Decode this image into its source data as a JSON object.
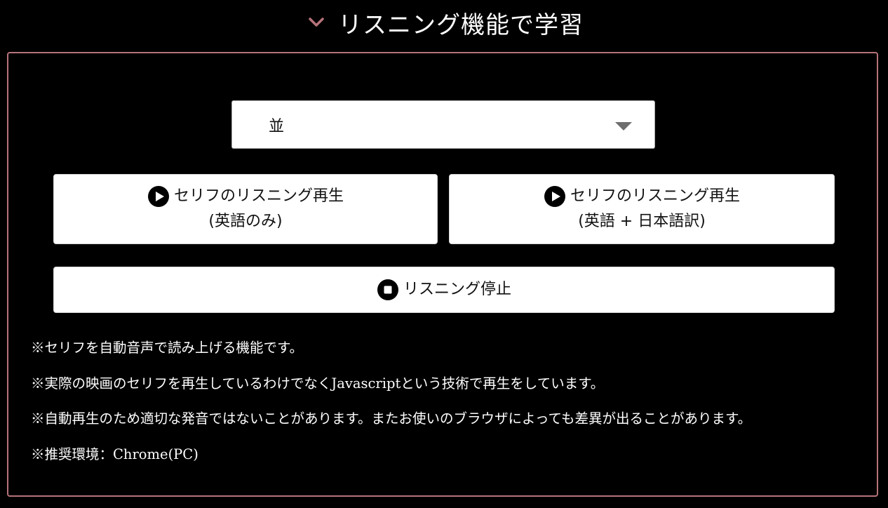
{
  "header": {
    "title": "リスニング機能で学習",
    "icon": "chevron-down-icon",
    "accent_color": "#b6737a"
  },
  "voice_select": {
    "value": "並"
  },
  "buttons": {
    "play_english": {
      "line1": "セリフのリスニング再生",
      "line2": "(英語のみ)",
      "icon": "play-circle-icon"
    },
    "play_english_japanese": {
      "line1": "セリフのリスニング再生",
      "line2": "(英語 + 日本語訳)",
      "icon": "play-circle-icon"
    },
    "stop": {
      "label": "リスニング停止",
      "icon": "stop-circle-icon"
    }
  },
  "notes": [
    "※セリフを自動音声で読み上げる機能です。",
    "※実際の映画のセリフを再生しているわけでなくJavascriptという技術で再生をしています。",
    "※自動再生のため適切な発音ではないことがあります。またお使いのブラウザによっても差異が出ることがあります。",
    "※推奨環境：Chrome(PC)"
  ]
}
